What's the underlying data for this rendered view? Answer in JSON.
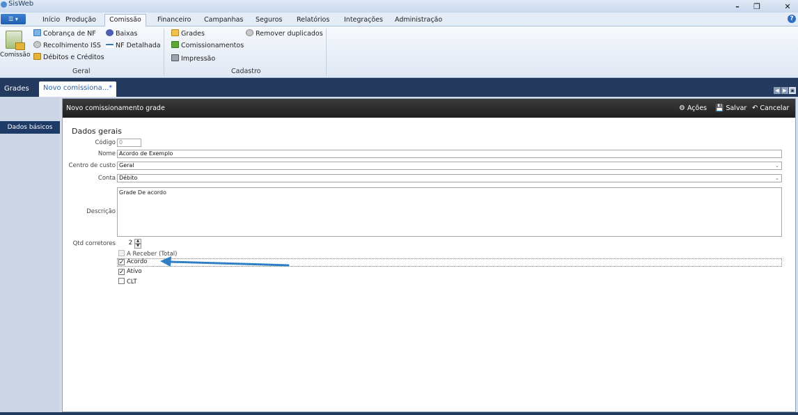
{
  "window": {
    "title": "SisWeb"
  },
  "menu": {
    "tabs": [
      {
        "label": "Início",
        "active": false
      },
      {
        "label": "Produção",
        "active": false
      },
      {
        "label": "Comissão",
        "active": true
      },
      {
        "label": "Financeiro",
        "active": false
      },
      {
        "label": "Campanhas",
        "active": false
      },
      {
        "label": "Seguros",
        "active": false
      },
      {
        "label": "Relatórios",
        "active": false
      },
      {
        "label": "Integrações",
        "active": false
      },
      {
        "label": "Administração",
        "active": false
      }
    ]
  },
  "ribbon": {
    "big_button": "Comissão",
    "geral": {
      "items": [
        "Cobrança de NF",
        "Baixas",
        "Recolhimento ISS",
        "NF Detalhada",
        "Débitos e Créditos"
      ],
      "label": "Geral"
    },
    "cadastro": {
      "items": [
        "Grades",
        "Remover duplicados",
        "Comissionamentos",
        "Impressão"
      ],
      "label": "Cadastro"
    }
  },
  "doc_tabs": [
    {
      "label": "Grades",
      "active": false
    },
    {
      "label": "Novo comissiona...*",
      "active": true
    }
  ],
  "left_nav": {
    "items": [
      "Dados básicos"
    ]
  },
  "panel": {
    "title": "Novo comissionamento grade",
    "actions": [
      "Ações",
      "Salvar",
      "Cancelar"
    ],
    "section": "Dados gerais",
    "fields": {
      "codigo": {
        "label": "Código",
        "value": "0"
      },
      "nome": {
        "label": "Nome",
        "value": "Acordo de Exemplo"
      },
      "centro_custo": {
        "label": "Centro de custo",
        "value": "Geral"
      },
      "conta": {
        "label": "Conta",
        "value": "Débito"
      },
      "descricao": {
        "label": "Descrição",
        "value": "Grade De acordo"
      },
      "qtd_corretores": {
        "label": "Qtd corretores",
        "value": "2"
      }
    },
    "checkboxes": [
      {
        "label": "A Receber (Total)",
        "checked": false,
        "enabled": false
      },
      {
        "label": "Acordo",
        "checked": true,
        "enabled": true
      },
      {
        "label": "Ativo",
        "checked": true,
        "enabled": true
      },
      {
        "label": "CLT",
        "checked": false,
        "enabled": true
      }
    ]
  },
  "colors": {
    "accent": "#2f7fc6",
    "nav_dark": "#1e3a66",
    "header_dark": "#262626"
  }
}
